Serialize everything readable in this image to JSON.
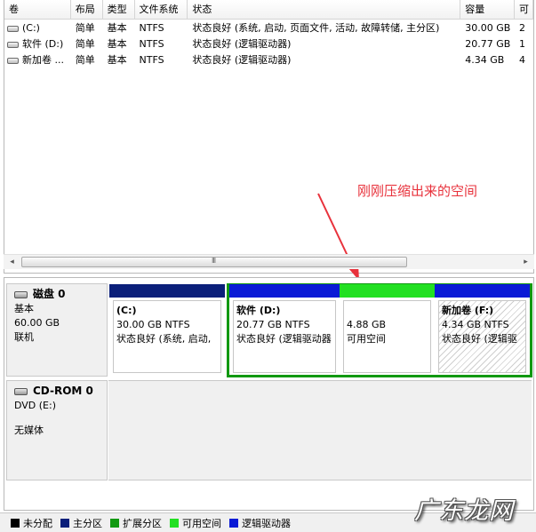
{
  "table": {
    "headers": [
      "卷",
      "布局",
      "类型",
      "文件系统",
      "状态",
      "容量",
      "可"
    ],
    "rows": [
      {
        "volume": "(C:)",
        "layout": "简单",
        "type": "基本",
        "fs": "NTFS",
        "status": "状态良好 (系统, 启动, 页面文件, 活动, 故障转储, 主分区)",
        "capacity": "30.00 GB",
        "free": "2"
      },
      {
        "volume": "软件 (D:)",
        "layout": "简单",
        "type": "基本",
        "fs": "NTFS",
        "status": "状态良好 (逻辑驱动器)",
        "capacity": "20.77 GB",
        "free": "1"
      },
      {
        "volume": "新加卷 ...",
        "layout": "简单",
        "type": "基本",
        "fs": "NTFS",
        "status": "状态良好 (逻辑驱动器)",
        "capacity": "4.34 GB",
        "free": "4"
      }
    ]
  },
  "annotation": "刚刚压缩出来的空间",
  "scrollbar": {
    "left": "◂",
    "right": "▸",
    "grip": "III"
  },
  "disk0": {
    "name": "磁盘 0",
    "type": "基本",
    "size": "60.00 GB",
    "status": "联机"
  },
  "cdrom": {
    "name": "CD-ROM 0",
    "drive": "DVD (E:)",
    "media": "无媒体"
  },
  "partitions": [
    {
      "name": "(C:)",
      "size": "30.00 GB NTFS",
      "status": "状态良好 (系统, 启动,",
      "color": "#0b1f7a"
    },
    {
      "name": "软件  (D:)",
      "size": "20.77 GB NTFS",
      "status": "状态良好 (逻辑驱动器",
      "color": "#0a1bd6"
    },
    {
      "name": "",
      "size": "4.88 GB",
      "status": "可用空间",
      "color": "#22e022"
    },
    {
      "name": "新加卷  (F:)",
      "size": "4.34 GB NTFS",
      "status": "状态良好 (逻辑驱",
      "color": "#0a1bd6"
    }
  ],
  "legend": [
    {
      "label": "未分配",
      "color": "#000000"
    },
    {
      "label": "主分区",
      "color": "#0b1f7a"
    },
    {
      "label": "扩展分区",
      "color": "#119911"
    },
    {
      "label": "可用空间",
      "color": "#22e022"
    },
    {
      "label": "逻辑驱动器",
      "color": "#0a1bd6"
    }
  ],
  "watermark": "广东龙网"
}
